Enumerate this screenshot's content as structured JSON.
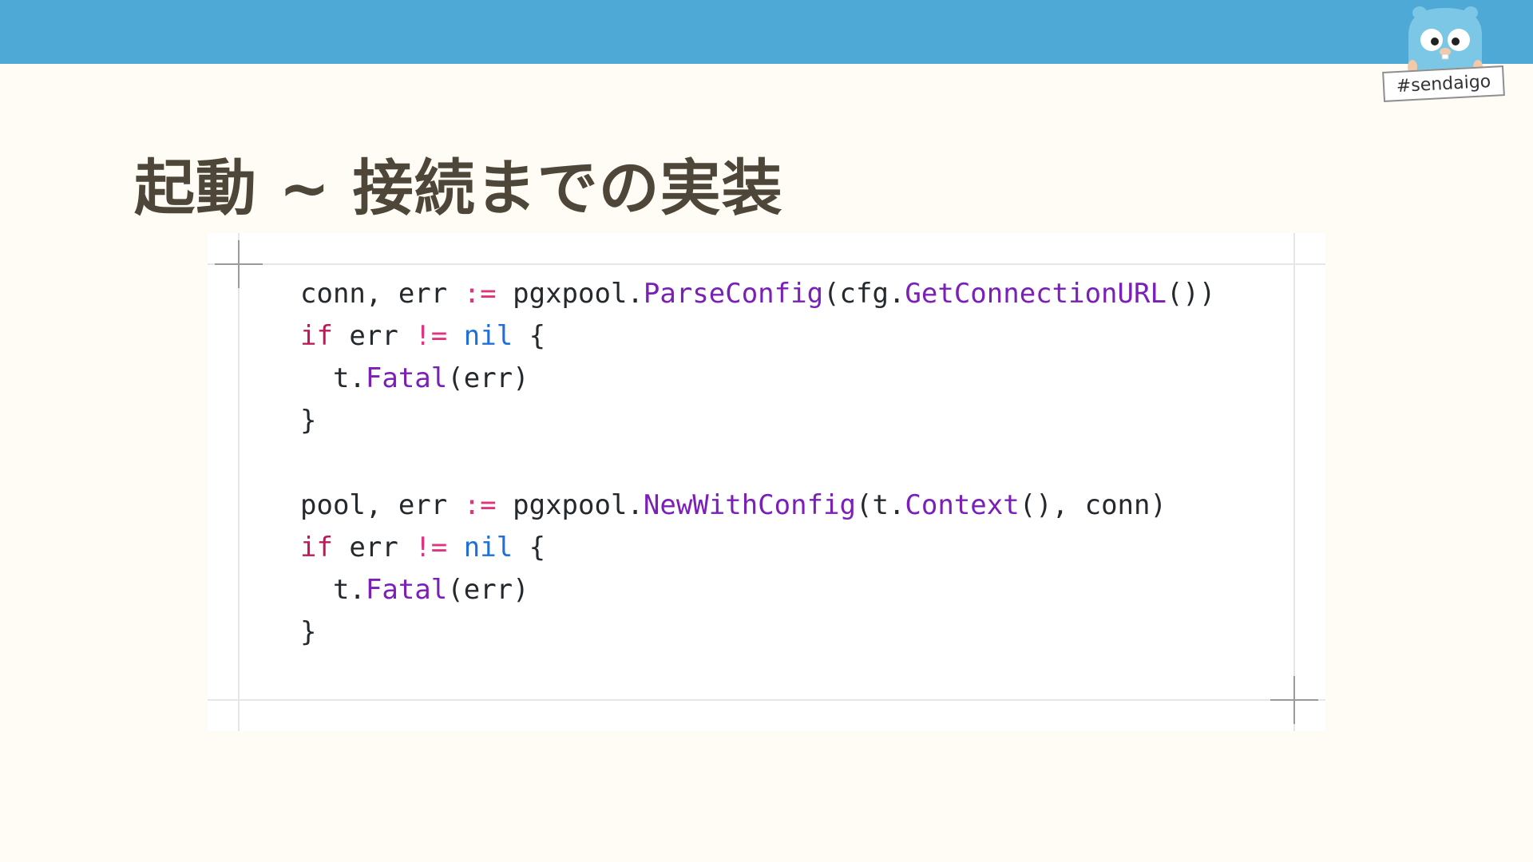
{
  "slide": {
    "title": "起動 ~ 接続までの実装",
    "tag": "#sendaigo",
    "mascot_icon": "gopher-mascot-icon"
  },
  "colors": {
    "header_bar": "#4fa9d6",
    "background": "#fefcf4",
    "title": "#4d4639",
    "code_default": "#24292e",
    "code_keyword": "#c2185b",
    "code_operator": "#e0347e",
    "code_nil": "#1e6fd9",
    "code_function": "#7b1fb8"
  },
  "code": {
    "lines": [
      [
        [
          "conn, err ",
          "default"
        ],
        [
          ":=",
          "operator"
        ],
        [
          " pgxpool.",
          "default"
        ],
        [
          "ParseConfig",
          "function"
        ],
        [
          "(cfg.",
          "default"
        ],
        [
          "GetConnectionURL",
          "function"
        ],
        [
          "())",
          "default"
        ]
      ],
      [
        [
          "if",
          "keyword"
        ],
        [
          " err ",
          "default"
        ],
        [
          "!=",
          "operator"
        ],
        [
          " ",
          "default"
        ],
        [
          "nil",
          "nil"
        ],
        [
          " {",
          "default"
        ]
      ],
      [
        [
          "  t.",
          "default"
        ],
        [
          "Fatal",
          "function"
        ],
        [
          "(err)",
          "default"
        ]
      ],
      [
        [
          "}",
          "default"
        ]
      ],
      [],
      [
        [
          "pool, err ",
          "default"
        ],
        [
          ":=",
          "operator"
        ],
        [
          " pgxpool.",
          "default"
        ],
        [
          "NewWithConfig",
          "function"
        ],
        [
          "(t.",
          "default"
        ],
        [
          "Context",
          "function"
        ],
        [
          "(), conn)",
          "default"
        ]
      ],
      [
        [
          "if",
          "keyword"
        ],
        [
          " err ",
          "default"
        ],
        [
          "!=",
          "operator"
        ],
        [
          " ",
          "default"
        ],
        [
          "nil",
          "nil"
        ],
        [
          " {",
          "default"
        ]
      ],
      [
        [
          "  t.",
          "default"
        ],
        [
          "Fatal",
          "function"
        ],
        [
          "(err)",
          "default"
        ]
      ],
      [
        [
          "}",
          "default"
        ]
      ]
    ]
  }
}
